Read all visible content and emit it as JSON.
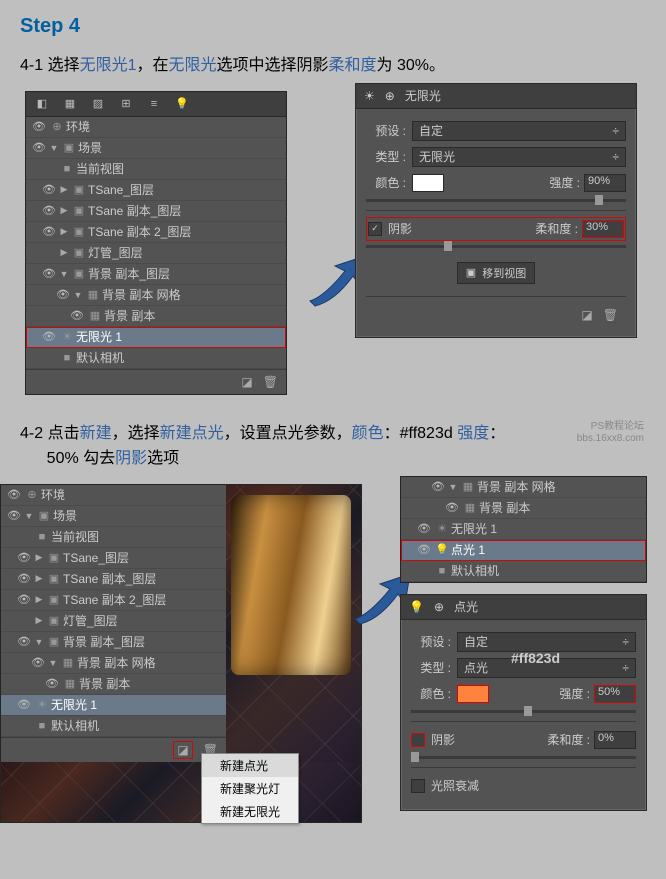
{
  "step": {
    "prefix": "Step ",
    "num": "4"
  },
  "instr1": {
    "pre": "4-1 选择",
    "l1": "无限光1",
    "mid1": "，在",
    "l2": "无限光",
    "mid2": "选项中选择阴影",
    "l3": "柔和度",
    "post": "为 30%。"
  },
  "instr2": {
    "pre": "4-2 点击",
    "l1": "新建",
    "mid1": "，选择",
    "l2": "新建点光",
    "mid2": "，设置点光参数，",
    "l3": "颜色",
    "mid3": "：#ff823d  ",
    "l4": "强度",
    "post": "：",
    "line2a": "50%   勾去",
    "line2b": "阴影",
    "line2c": "选项"
  },
  "layers": {
    "env": "环境",
    "scene": "场景",
    "curview": "当前视图",
    "tsane": "TSane_图层",
    "tsane_copy": "TSane 副本_图层",
    "tsane_copy2": "TSane 副本 2_图层",
    "lamp": "灯管_图层",
    "bg_copy_layer": "背景 副本_图层",
    "bg_mesh": "背景 副本 网格",
    "bg_copy": "背景 副本",
    "infinite": "无限光 1",
    "point": "点光 1",
    "camera": "默认相机"
  },
  "infinite_panel": {
    "title": "无限光",
    "preset": "预设 :",
    "preset_val": "自定",
    "type": "类型 :",
    "type_val": "无限光",
    "color": "颜色 :",
    "intensity": "强度 :",
    "intensity_val": "90%",
    "shadow": "阴影",
    "softness": "柔和度 :",
    "softness_val": "30%",
    "move": "移到视图"
  },
  "point_panel": {
    "title": "点光",
    "preset": "预设 :",
    "preset_val": "自定",
    "type": "类型 :",
    "type_val": "点光",
    "color": "颜色 :",
    "color_hex": "#ff823d",
    "intensity": "强度 :",
    "intensity_val": "50%",
    "shadow": "阴影",
    "softness": "柔和度 :",
    "softness_val": "0%",
    "falloff": "光照衰减"
  },
  "menu": {
    "point": "新建点光",
    "spot": "新建聚光灯",
    "infinite": "新建无限光"
  },
  "watermark": {
    "l1": "PS教程论坛",
    "l2": "bbs.16xx8.com"
  },
  "icons": {
    "eye": "👁",
    "folder": "▣",
    "camera": "■",
    "light": "☀",
    "bulb": "💡",
    "trash": "🗑",
    "new": "◪",
    "close": "✕",
    "tri_r": "▶",
    "tri_d": "▼",
    "car": "÷"
  }
}
